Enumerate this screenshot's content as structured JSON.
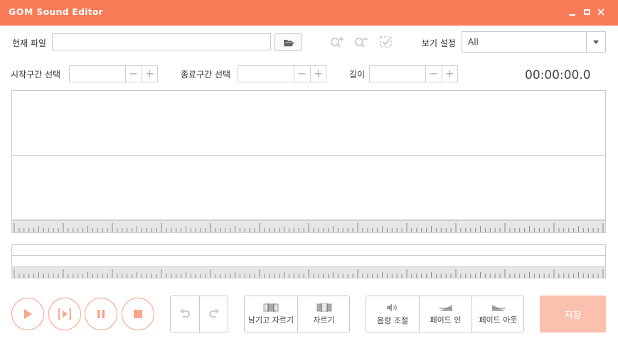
{
  "window": {
    "title_brand": "GOM",
    "title_rest": " Sound Editor",
    "accent": "#f97a57"
  },
  "file": {
    "label": "현재 파일",
    "value": "",
    "open_icon": "folder-open-icon"
  },
  "toolbar": {
    "icons": [
      "zoom-in-icon",
      "zoom-out-icon",
      "check-select-icon"
    ]
  },
  "view": {
    "label": "보기 설정",
    "selected": "All"
  },
  "range": {
    "start_label": "시작구간 선택",
    "end_label": "종료구간 선택",
    "length_label": "길이",
    "start_value": "",
    "end_value": "",
    "length_value": "",
    "minus": "−",
    "plus": "+"
  },
  "timecode": "00:00:00.0",
  "transport": {
    "icons": [
      "play-icon",
      "play-selection-icon",
      "pause-icon",
      "stop-icon"
    ],
    "undo_icon": "undo-icon",
    "redo_icon": "redo-icon"
  },
  "edit": {
    "trim_keep_label": "남기고 자르기",
    "cut_label": "자르기"
  },
  "effects": {
    "volume_label": "음량 조절",
    "fade_in_label": "페이드 인",
    "fade_out_label": "페이드 아웃"
  },
  "save_label": "저장",
  "save_color": "#fcc1ae"
}
